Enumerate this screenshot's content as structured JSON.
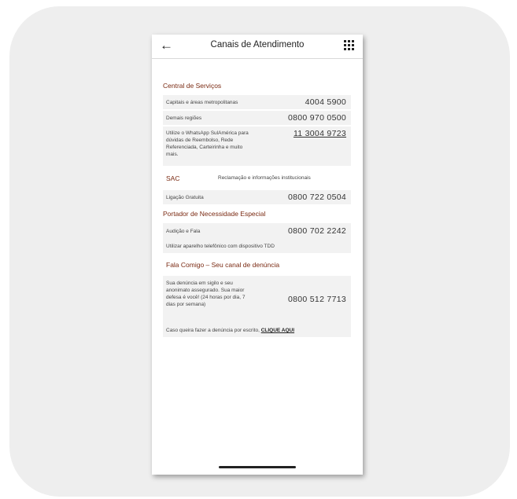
{
  "header": {
    "title": "Canais de Atendimento",
    "back_icon": "arrow-left-icon",
    "menu_icon": "grid-menu-icon"
  },
  "central": {
    "title": "Central de Serviços",
    "rows": [
      {
        "label": "Capitais e áreas metropolitanas",
        "phone": "4004 5900"
      },
      {
        "label": "Demais regiões",
        "phone": "0800 970 0500"
      },
      {
        "label": "Utilize o WhatsApp SulAmérica para dúvidas de Reembolso, Rede Referenciada, Carteirinha e muito mais.",
        "phone": "11 3004 9723"
      }
    ]
  },
  "sac": {
    "title": "SAC",
    "note": "Reclamação e informações institucionais",
    "rows": [
      {
        "label": "Ligação Gratuita",
        "phone": "0800 722 0504"
      }
    ]
  },
  "especial": {
    "title": "Portador de Necessidade Especial",
    "rows": [
      {
        "label": "Audição e Fala",
        "phone": "0800 702 2242"
      },
      {
        "label": "Utilizar aparelho telefônico com dispositivo TDD"
      }
    ]
  },
  "denuncia": {
    "title": "Fala Comigo – Seu canal de denúncia",
    "text": "Sua denúncia em sigilo e seu anonimato assegurado. Sua maior defesa é você! (24 horas por dia, 7 dias por semana)",
    "phone": "0800 512 7713",
    "written_prefix": "Caso queira fazer a denúncia por escrito, ",
    "written_link": "CLIQUE AQUI"
  },
  "colors": {
    "section_title": "#7a2a12",
    "row_bg": "#f2f2f2",
    "card_bg": "#eeeeee"
  }
}
